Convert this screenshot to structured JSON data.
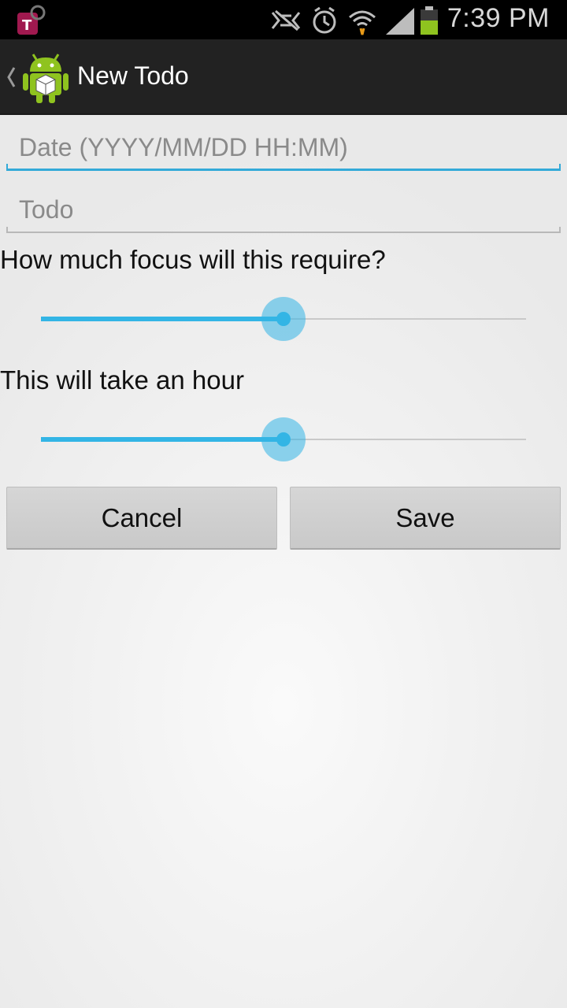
{
  "status_bar": {
    "time": "7:39 PM",
    "icons": [
      "carrier-icon",
      "no-sync-icon",
      "alarm-icon",
      "wifi-icon",
      "signal-icon",
      "battery-icon"
    ],
    "battery_color": "#8fc31f"
  },
  "action_bar": {
    "title": "New Todo",
    "up_icon": "chevron-left-icon",
    "app_icon": "android-icon"
  },
  "form": {
    "date_placeholder": "Date (YYYY/MM/DD HH:MM)",
    "todo_placeholder": "Todo",
    "focus_label": "How much focus will this require?",
    "focus_level": 0.5,
    "duration_label": "This will take an hour",
    "duration_level": 0.5
  },
  "buttons": {
    "cancel": "Cancel",
    "save": "Save"
  },
  "colors": {
    "accent": "#33b5e5",
    "actionbar_bg": "#222222"
  }
}
